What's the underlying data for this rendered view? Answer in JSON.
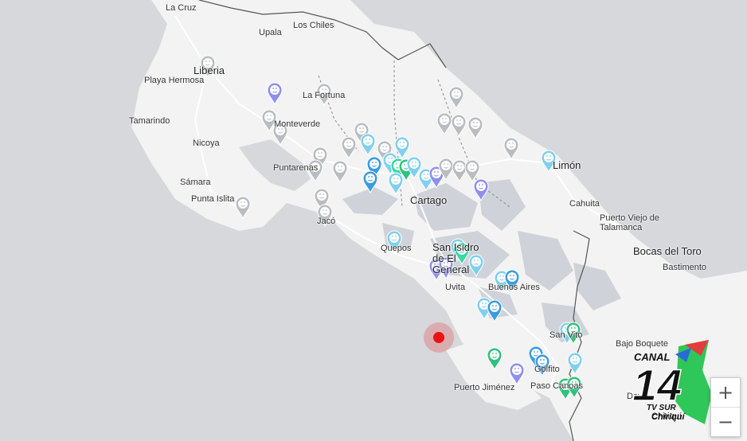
{
  "map": {
    "places": [
      {
        "id": "la-cruz",
        "name": "La Cruz"
      },
      {
        "id": "upala",
        "name": "Upala"
      },
      {
        "id": "los-chiles",
        "name": "Los Chiles"
      },
      {
        "id": "liberia",
        "name": "Liberia"
      },
      {
        "id": "playa-hermosa",
        "name": "Playa Hermosa"
      },
      {
        "id": "la-fortuna",
        "name": "La Fortuna"
      },
      {
        "id": "tamarindo",
        "name": "Tamarindo"
      },
      {
        "id": "monteverde",
        "name": "Monteverde"
      },
      {
        "id": "nicoya",
        "name": "Nicoya"
      },
      {
        "id": "puntarenas",
        "name": "Puntarenas"
      },
      {
        "id": "samara",
        "name": "Sámara"
      },
      {
        "id": "punta-islita",
        "name": "Punta Islita"
      },
      {
        "id": "jaco",
        "name": "Jacó"
      },
      {
        "id": "limon",
        "name": "Limón"
      },
      {
        "id": "cartago",
        "name": "Cartago"
      },
      {
        "id": "cahuita",
        "name": "Cahuita"
      },
      {
        "id": "puerto-viejo",
        "name": "Puerto Viejo de Talamanca"
      },
      {
        "id": "bocas-del-toro",
        "name": "Bocas del Toro"
      },
      {
        "id": "bastimento",
        "name": "Bastimento"
      },
      {
        "id": "quepos",
        "name": "Quepos"
      },
      {
        "id": "san-isidro",
        "name": "San Isidro de El General"
      },
      {
        "id": "uvita",
        "name": "Uvita"
      },
      {
        "id": "buenos-aires",
        "name": "Buenos Aires"
      },
      {
        "id": "san-vito",
        "name": "San Vito"
      },
      {
        "id": "bajo-boquete",
        "name": "Bajo Boquete"
      },
      {
        "id": "golfito",
        "name": "Golfito"
      },
      {
        "id": "puerto-jimenez",
        "name": "Puerto Jiménez"
      },
      {
        "id": "paso-canoas",
        "name": "Paso Canoas"
      },
      {
        "id": "david",
        "name": "David"
      },
      {
        "id": "chiriqui",
        "name": "Chiriquí"
      }
    ],
    "epicenter_color": "#ee1111",
    "marker_colors": {
      "gray": "#b8bdc2",
      "lightblue": "#7fd0ee",
      "blue": "#3a9be0",
      "teal": "#38d8a0",
      "green": "#2ec27e",
      "purple": "#8f8ff0"
    }
  },
  "controls": {
    "zoom_in": "+",
    "zoom_out": "−"
  },
  "logo": {
    "channel": "CANAL",
    "number": "14",
    "line1": "TV SUR",
    "line2": "Chiriquí"
  }
}
